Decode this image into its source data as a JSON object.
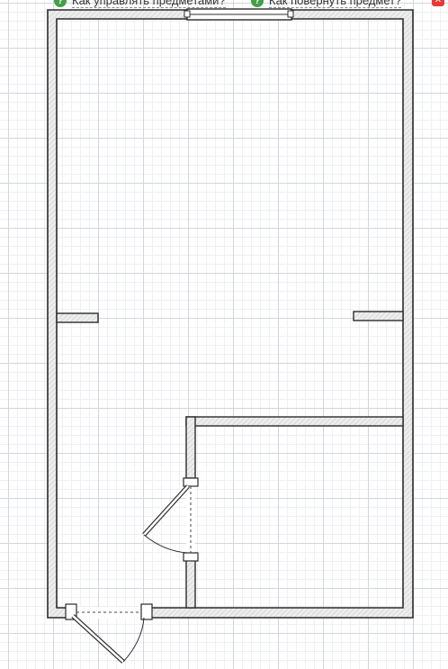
{
  "toolbar": {
    "help_manage_label": "Как управлять предметами?",
    "help_rotate_label": "Как повернуть предмет?",
    "help_icon_symbol": "?",
    "close_symbol": "✕"
  },
  "colors": {
    "help_icon": "#43a047",
    "close_button": "#e53935",
    "wall_fill": "#e9e9e9",
    "wall_stroke": "#2b2b2b"
  }
}
